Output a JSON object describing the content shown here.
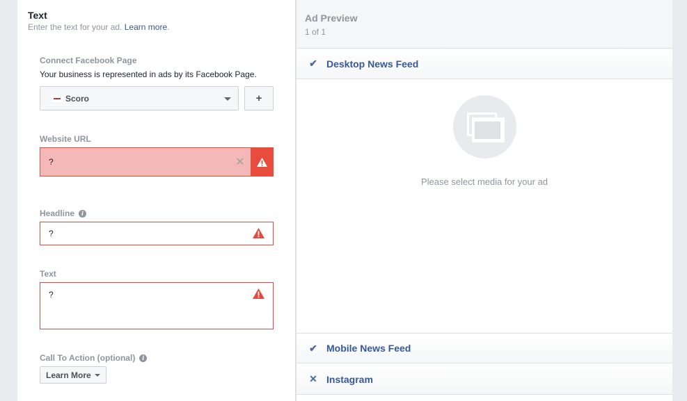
{
  "form": {
    "section_title": "Text",
    "section_subtitle": "Enter the text for your ad.",
    "learn_more_link": "Learn more",
    "learn_more_suffix": ".",
    "connect_page": {
      "label": "Connect Facebook Page",
      "helper": "Your business is represented in ads by its Facebook Page.",
      "selected_page": "Scoro",
      "add_button": "+"
    },
    "website_url": {
      "label": "Website URL",
      "value": "?",
      "clear_icon": "close-icon",
      "status": "error"
    },
    "headline": {
      "label": "Headline",
      "value": "?",
      "status": "error"
    },
    "text": {
      "label": "Text",
      "value": "?",
      "status": "error"
    },
    "call_to_action": {
      "label": "Call To Action (optional)",
      "selected": "Learn More"
    }
  },
  "preview": {
    "title": "Ad Preview",
    "count": "1 of 1",
    "placements": [
      {
        "label": "Desktop News Feed",
        "enabled": true,
        "icon": "checkmark-icon"
      },
      {
        "label": "Mobile News Feed",
        "enabled": true,
        "icon": "checkmark-icon"
      },
      {
        "label": "Instagram",
        "enabled": false,
        "icon": "x-icon"
      }
    ],
    "empty_message": "Please select media for your ad"
  },
  "colors": {
    "error_red": "#e74c3c",
    "error_fill": "#f5b8b8",
    "link_blue": "#365899",
    "muted_gray": "#90949c"
  }
}
